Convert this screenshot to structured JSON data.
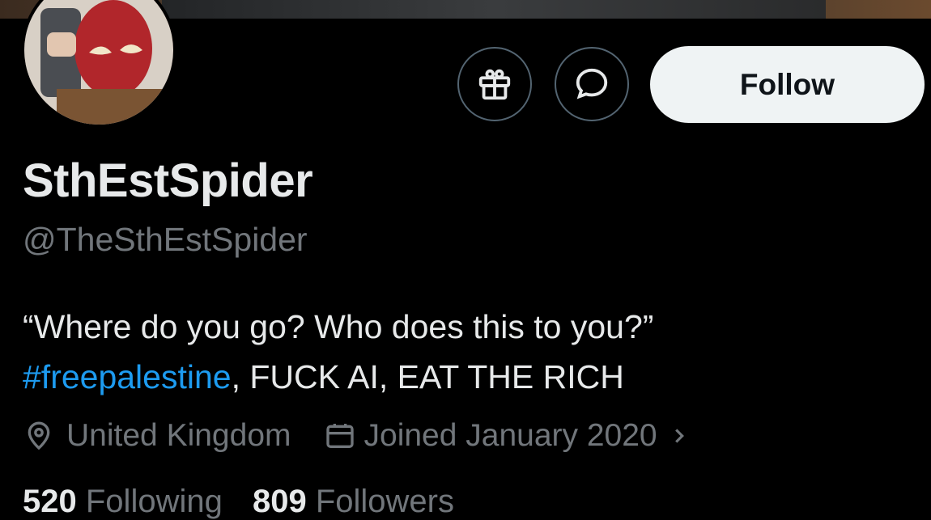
{
  "profile": {
    "display_name": "SthEstSpider",
    "handle": "@TheSthEstSpider",
    "bio_line1": "“Where do you go? Who does this to you?”",
    "bio_hashtag": "#freepalestine",
    "bio_line2_rest": ", FUCK AI, EAT THE RICH",
    "location": "United Kingdom",
    "joined": "Joined January 2020",
    "following_count": "520",
    "following_label": "Following",
    "followers_count": "809",
    "followers_label": "Followers"
  },
  "actions": {
    "gift_icon": "gift-icon",
    "message_icon": "message-icon",
    "follow_label": "Follow"
  },
  "colors": {
    "background": "#000000",
    "text": "#e7e9ea",
    "muted": "#71767b",
    "link": "#1d9bf0",
    "follow_bg": "#eff3f4"
  }
}
